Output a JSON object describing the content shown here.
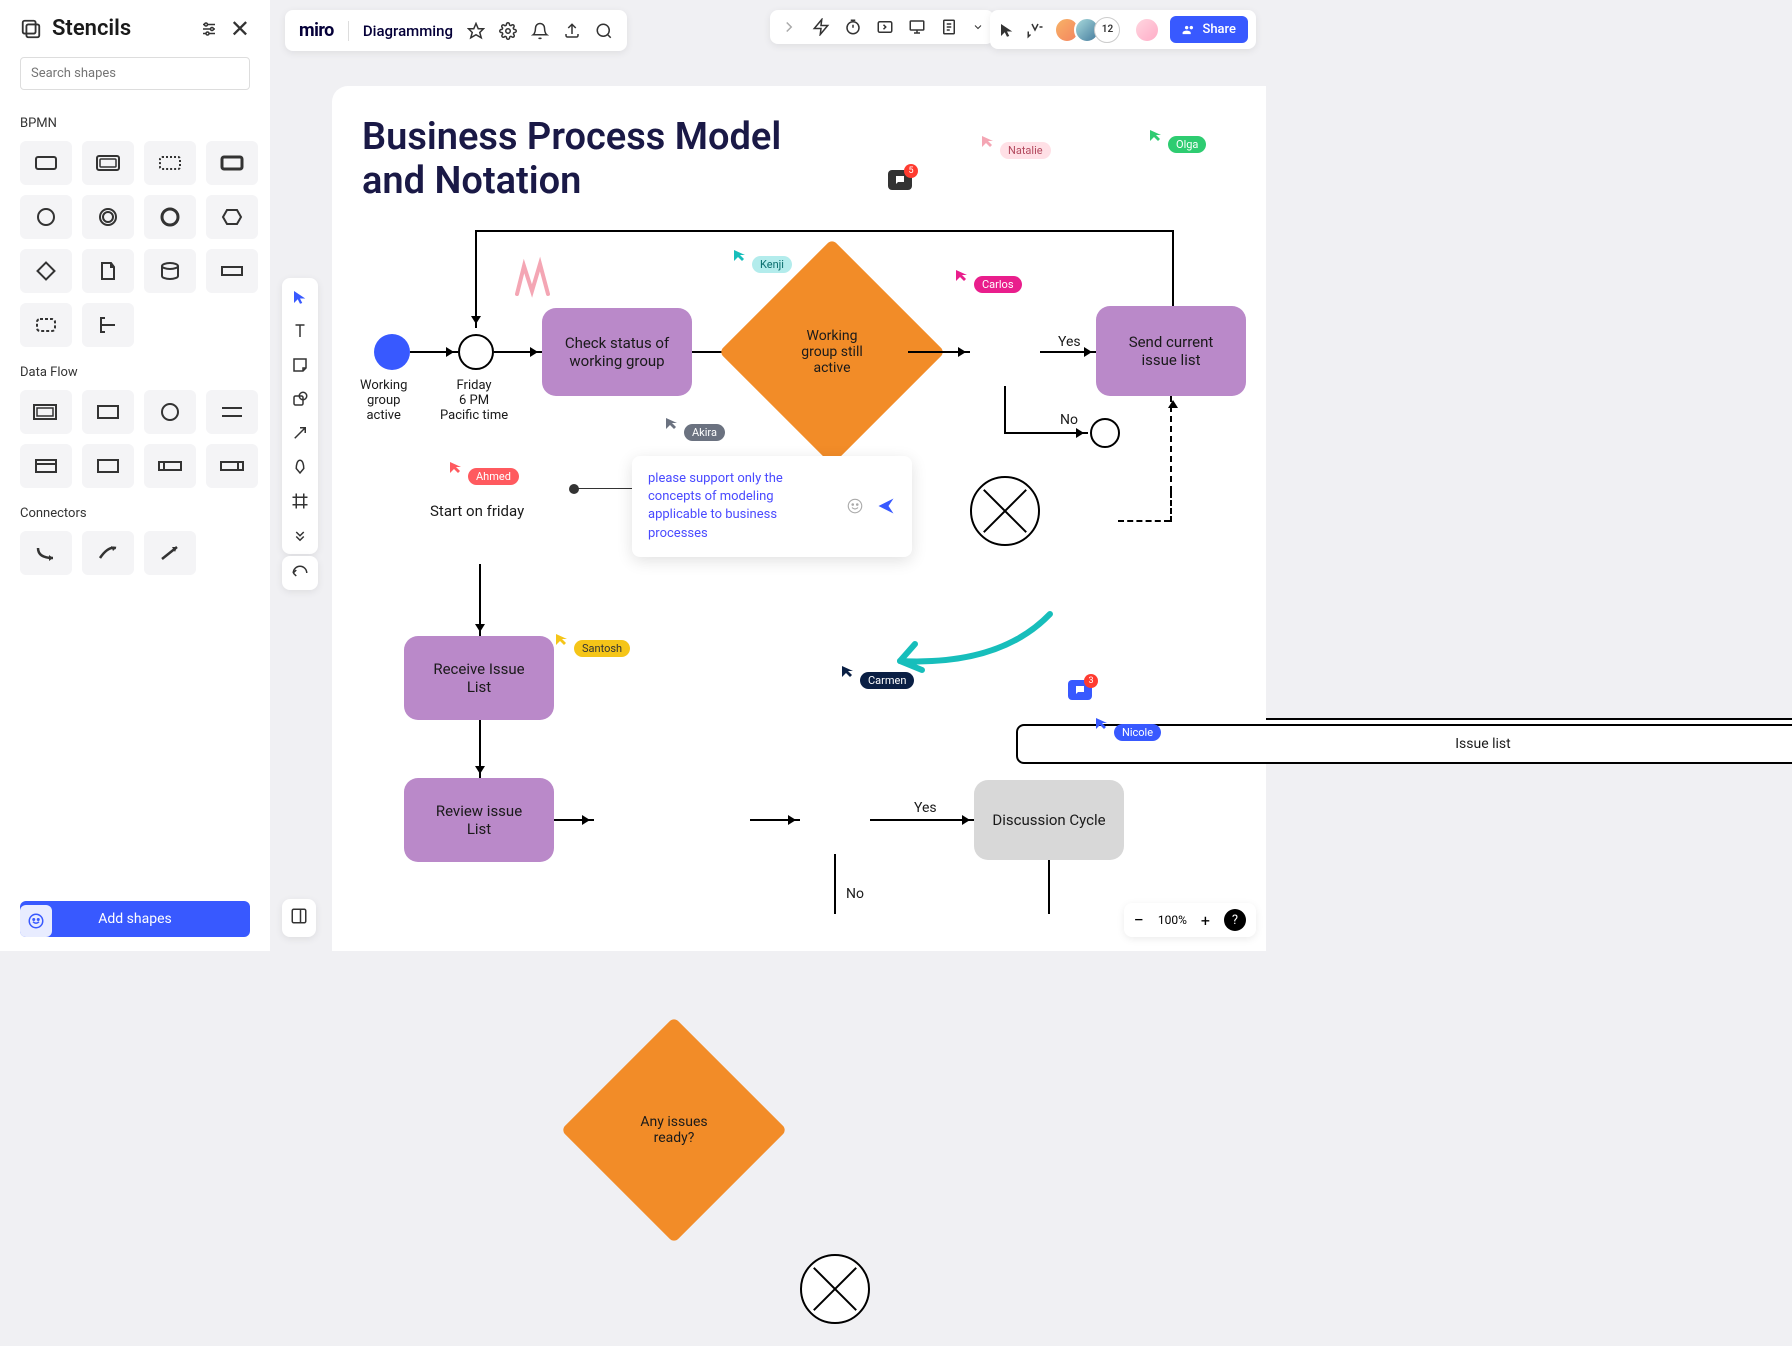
{
  "sidebar": {
    "title": "Stencils",
    "search_placeholder": "Search shapes",
    "sections": {
      "bpmn": "BPMN",
      "dataflow": "Data Flow",
      "connectors": "Connectors"
    },
    "add_shapes": "Add shapes"
  },
  "header": {
    "logo": "miro",
    "board_name": "Diagramming",
    "share": "Share",
    "avatar_count": "12"
  },
  "zoom": {
    "level": "100%"
  },
  "canvas": {
    "title": "Business Process Model\nand Notation",
    "nodes": {
      "start_label": "Working\ngroup\nactive",
      "timer_label": "Friday\n6 PM\nPacific time",
      "check_status": "Check status of\nworking group",
      "wg_active": "Working\ngroup still\nactive",
      "send_list": "Send current issue\nlist",
      "issue_list": "Issue list",
      "start_friday": "Start on friday",
      "receive": "Receive Issue List",
      "review": "Review issue List",
      "any_issues": "Any issues\nready?",
      "discussion": "Discussion Cycle"
    },
    "edges": {
      "yes1": "Yes",
      "no1": "No",
      "yes2": "Yes",
      "no2": "No"
    },
    "comment": "please support only the concepts of modeling applicable to business processes",
    "cursors": {
      "kenji": "Kenji",
      "natalie": "Natalie",
      "olga": "Olga",
      "carlos": "Carlos",
      "akira": "Akira",
      "ahmed": "Ahmed",
      "santosh": "Santosh",
      "carmen": "Carmen",
      "nicole": "Nicole"
    },
    "badges": {
      "comment1": "5",
      "comment2": "3"
    }
  }
}
